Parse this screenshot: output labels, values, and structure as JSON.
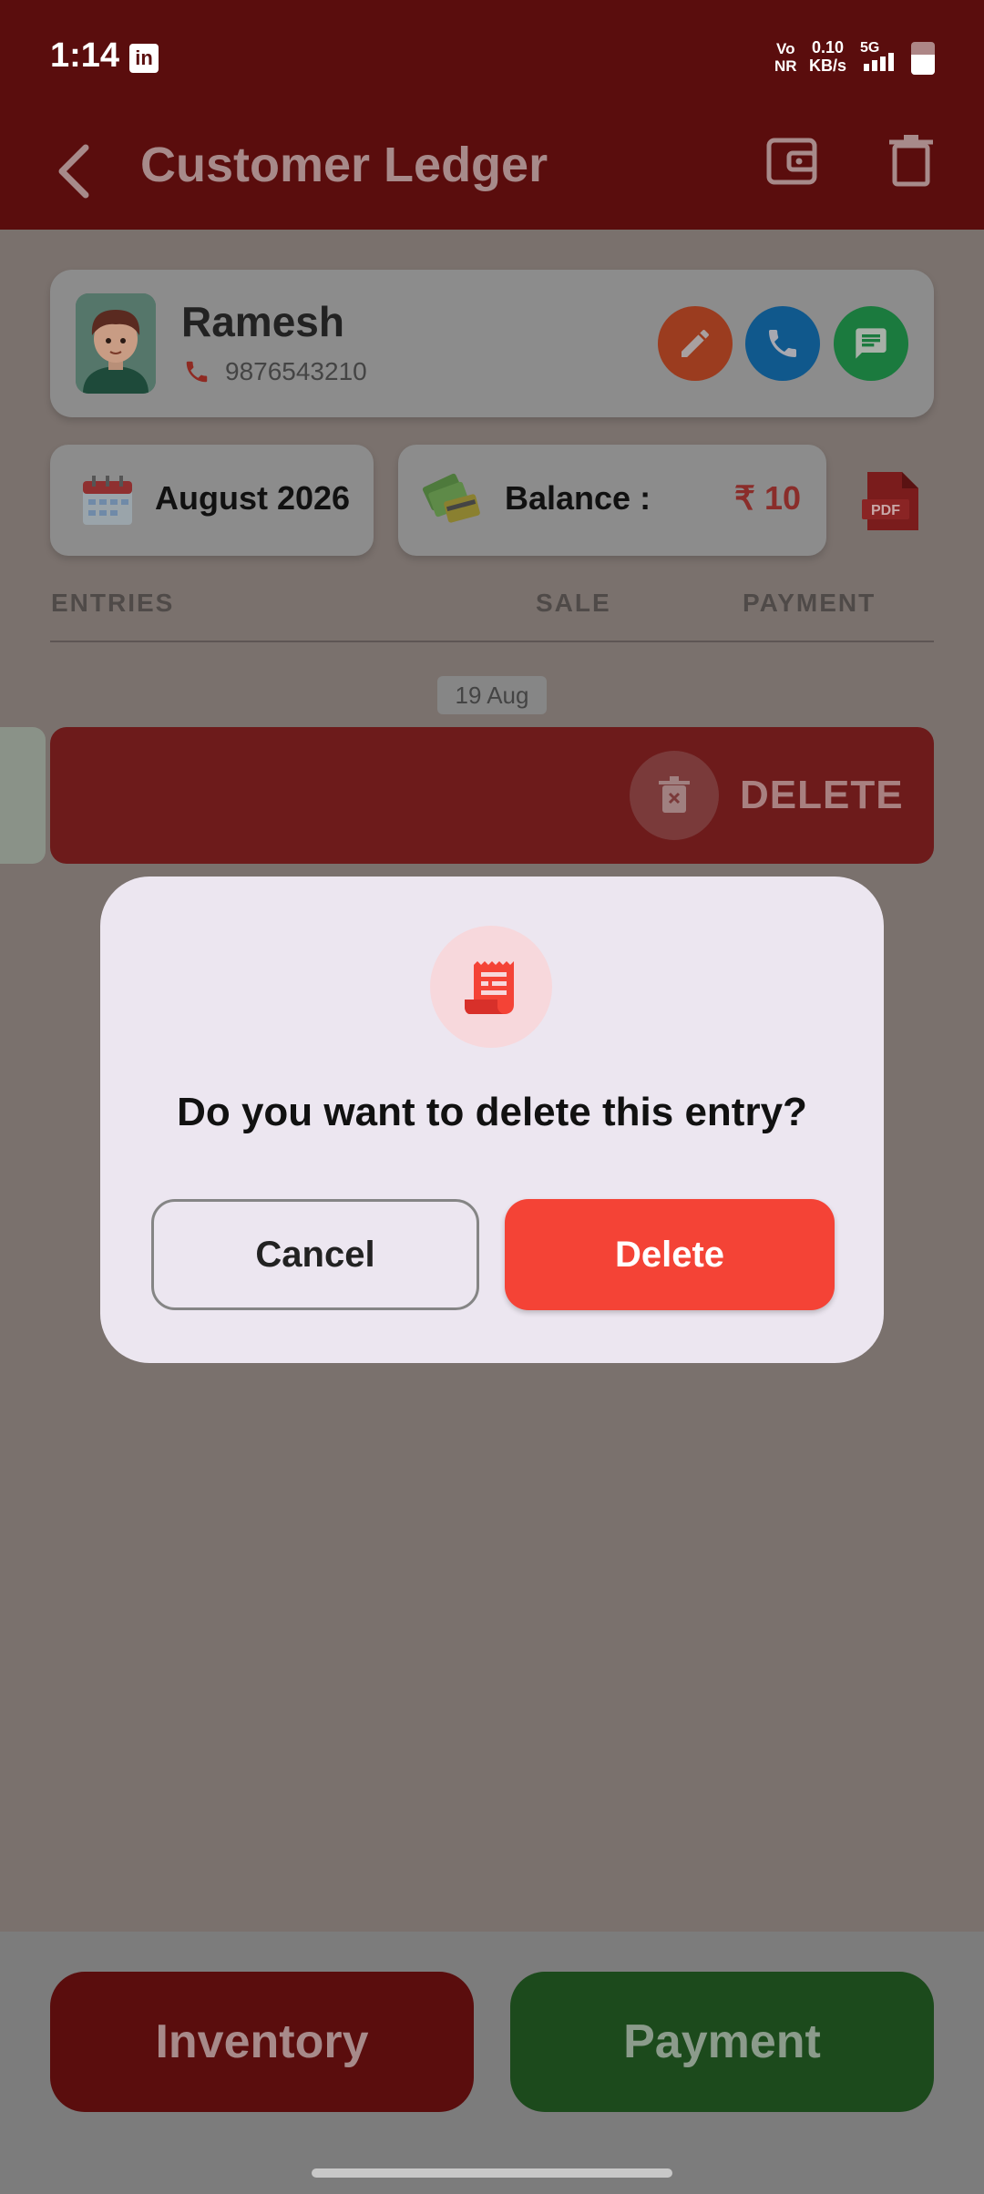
{
  "status_bar": {
    "time": "1:14",
    "app_badge": "in",
    "vo_nr": [
      "Vo",
      "NR"
    ],
    "speed": [
      "0.10",
      "KB/s"
    ],
    "network": "5G"
  },
  "app_bar": {
    "title": "Customer Ledger"
  },
  "customer": {
    "name": "Ramesh",
    "phone": "9876543210"
  },
  "summary": {
    "month": "August 2026",
    "balance_label": "Balance :",
    "balance_value": "₹ 10",
    "pdf_label": "PDF"
  },
  "table": {
    "columns": [
      "ENTRIES",
      "SALE",
      "PAYMENT"
    ],
    "date_group": "19 Aug",
    "swipe_action": "DELETE"
  },
  "dialog": {
    "message": "Do you want to delete this entry?",
    "cancel_label": "Cancel",
    "delete_label": "Delete"
  },
  "bottom": {
    "inventory_label": "Inventory",
    "payment_label": "Payment"
  },
  "colors": {
    "primary": "#8b1a1a",
    "delete": "#f44336",
    "payment": "#2e6b2e",
    "dialog_bg": "#ece6f0"
  }
}
